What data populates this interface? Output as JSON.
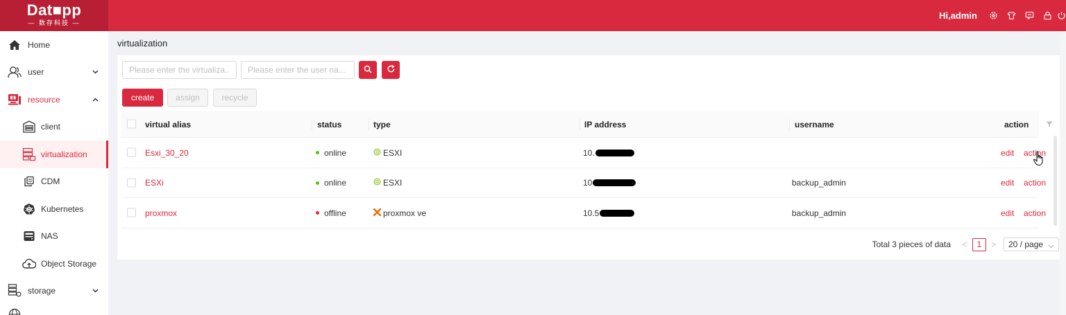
{
  "header": {
    "logo_main": "Dat■pp",
    "logo_sub": "— 数存科技 —",
    "greeting": "Hi,admin",
    "icons": [
      "gear-icon",
      "shirt-icon",
      "chat-icon",
      "lock-icon",
      "power-icon"
    ]
  },
  "sidebar": {
    "items": [
      {
        "label": "Home",
        "icon": "home-icon"
      },
      {
        "label": "user",
        "icon": "user-icon"
      },
      {
        "label": "resource",
        "icon": "monitor-icon"
      },
      {
        "label": "client",
        "icon": "client-icon"
      },
      {
        "label": "virtualization",
        "icon": "server-icon"
      },
      {
        "label": "CDM",
        "icon": "copy-icon"
      },
      {
        "label": "Kubernetes",
        "icon": "kubernetes-icon"
      },
      {
        "label": "NAS",
        "icon": "nas-icon"
      },
      {
        "label": "Object Storage",
        "icon": "cloud-icon"
      },
      {
        "label": "storage",
        "icon": "storage-icon"
      }
    ]
  },
  "page": {
    "title": "virtualization"
  },
  "toolbar": {
    "search_alias_placeholder": "Please enter the virtualiza...",
    "search_user_placeholder": "Please enter the user na...",
    "create_label": "create",
    "assign_label": "assign",
    "recycle_label": "recycle"
  },
  "table": {
    "columns": [
      "virtual alias",
      "status",
      "type",
      "IP address",
      "username",
      "action"
    ],
    "rows": [
      {
        "alias": "Esxi_30_20",
        "status": "online",
        "type": "ESXI",
        "ip_prefix": "10.",
        "username": "",
        "edit": "edit",
        "action": "action"
      },
      {
        "alias": "ESXi",
        "status": "online",
        "type": "ESXI",
        "ip_prefix": "10",
        "username": "backup_admin",
        "edit": "edit",
        "action": "action"
      },
      {
        "alias": "proxmox",
        "status": "offline",
        "type": "proxmox ve",
        "ip_prefix": "10.5",
        "username": "backup_admin",
        "edit": "edit",
        "action": "action"
      }
    ]
  },
  "pagination": {
    "total": "Total 3 pieces of data",
    "prev": "<",
    "page": "1",
    "next": ">",
    "page_size": "20 / page"
  },
  "colors": {
    "brand": "#d9293e",
    "online": "#52c41a",
    "offline": "#f5222d",
    "esxi_icon": "#a0c43b",
    "proxmox_icon": "#e57000"
  }
}
